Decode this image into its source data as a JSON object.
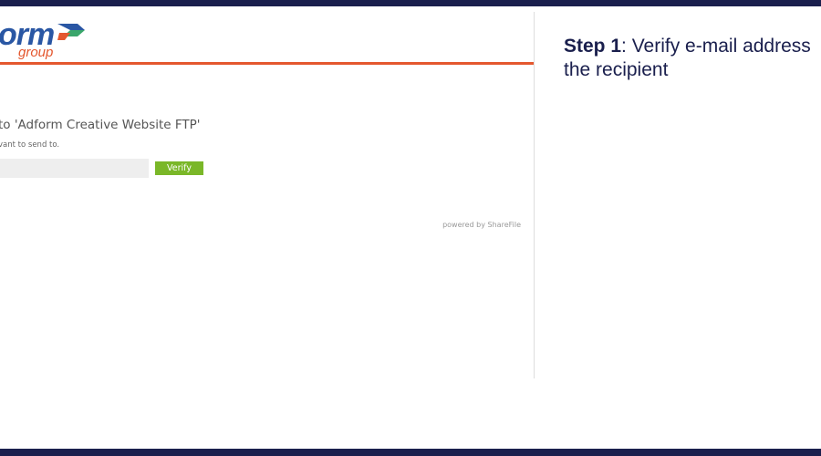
{
  "colors": {
    "frame_bar": "#1a1f4d",
    "logo_blue": "#2a57a4",
    "logo_orange": "#e4572e",
    "arrow_green": "#3aa66b",
    "header_rule": "#e4572e",
    "field_bg": "#eeeeee",
    "verify_green": "#7ab728",
    "divider": "#dddddd",
    "step_text": "#1a1f4d"
  },
  "logo": {
    "text": "orm",
    "sub": "group"
  },
  "page": {
    "heading": "to 'Adform Creative Website FTP'",
    "instruction": "vant to send to.",
    "email_value": "",
    "verify_label": "Verify",
    "powered_by": "powered by ShareFile"
  },
  "step": {
    "label": "Step 1",
    "text": ": Verify e-mail address",
    "text_line2": "the recipient"
  }
}
